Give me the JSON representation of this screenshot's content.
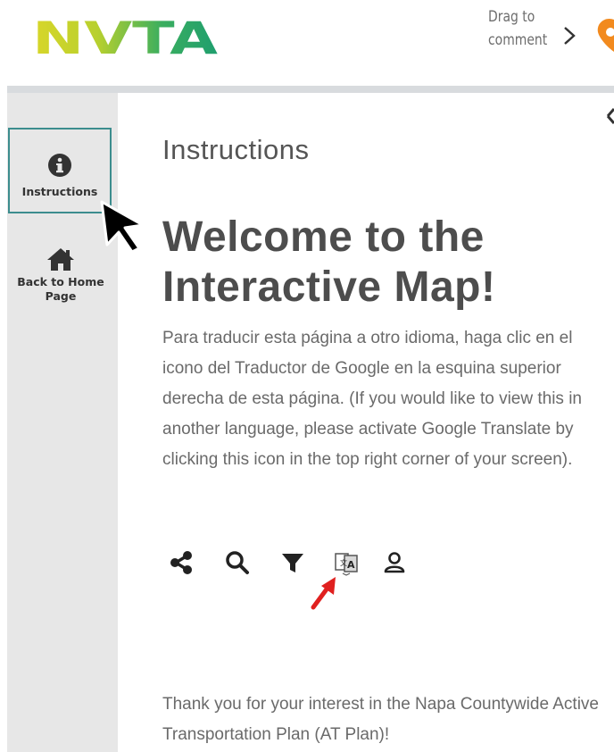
{
  "header": {
    "logo_text": "NVTA",
    "drag_label_line1": "Drag to",
    "drag_label_line2": "comment"
  },
  "sidebar": {
    "items": [
      {
        "label": "Instructions",
        "icon": "info-icon",
        "active": true
      },
      {
        "label_line1": "Back to Home",
        "label_line2": "Page",
        "icon": "home-icon",
        "active": false
      }
    ]
  },
  "main": {
    "section_title": "Instructions",
    "headline_line1": "Welcome to the",
    "headline_line2": "Interactive Map!",
    "paragraph": "Para traducir esta página a otro idioma, haga clic en el icono del Traductor de Google en la esquina superior derecha de esta página. (If you would like to view this in another language, please activate Google Translate by clicking this icon in the top right corner of your screen).",
    "toolbar_icons": [
      "share-icon",
      "search-icon",
      "filter-icon",
      "translate-icon",
      "user-icon"
    ],
    "thanks_text": "Thank you for your interest in the Napa Countywide Active Transportation Plan (AT Plan)!"
  },
  "colors": {
    "sidebar_bg": "#e7e7e7",
    "active_border": "#3c8d8e",
    "separator": "#d8dbde",
    "pin_orange": "#f28a1e",
    "arrow_red": "#e0201f",
    "logo_green": "#2fae6c",
    "logo_yellow": "#d6d628"
  }
}
